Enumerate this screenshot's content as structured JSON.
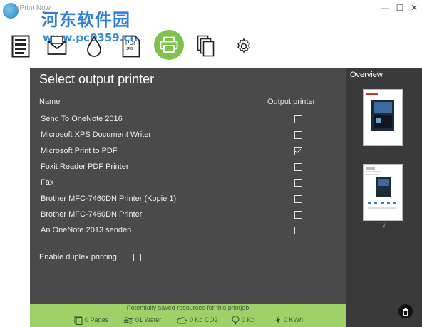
{
  "window": {
    "title": "ePrint Now",
    "watermark_title": "河东软件园",
    "watermark_url": "www.pc0359.cn",
    "controls": {
      "minimize": "—",
      "maximize": "☐",
      "close": "✕"
    }
  },
  "toolbar": {
    "tools": [
      {
        "name": "document",
        "icon": "document-icon"
      },
      {
        "name": "email",
        "icon": "envelope-icon"
      },
      {
        "name": "ink",
        "icon": "drop-icon"
      },
      {
        "name": "pdf",
        "icon": "pdf-icon",
        "label_top": "PDF",
        "label_bottom": "JPG"
      },
      {
        "name": "print",
        "icon": "printer-icon",
        "active": true
      },
      {
        "name": "copies",
        "icon": "copies-icon"
      },
      {
        "name": "settings",
        "icon": "gear-icon"
      }
    ]
  },
  "main": {
    "title": "Select output printer",
    "col_name": "Name",
    "col_output": "Output printer",
    "printers": [
      {
        "name": "Send To OneNote 2016",
        "checked": false
      },
      {
        "name": "Microsoft XPS Document Writer",
        "checked": false
      },
      {
        "name": "Microsoft Print to PDF",
        "checked": true
      },
      {
        "name": "Foxit Reader PDF Printer",
        "checked": false
      },
      {
        "name": "Fax",
        "checked": false
      },
      {
        "name": "Brother MFC-7460DN Printer (Kopie 1)",
        "checked": false
      },
      {
        "name": "Brother MFC-7460DN Printer",
        "checked": false
      },
      {
        "name": "An OneNote 2013 senden",
        "checked": false
      }
    ],
    "duplex_label": "Enable duplex printing",
    "duplex_checked": false
  },
  "savings": {
    "title": "Potentially saved resources for this printjob",
    "pages": "0 Pages",
    "water": "01 Water",
    "co2": "0 Kg  CO2",
    "wood": "0 Kg",
    "energy": "0 KWh"
  },
  "overview": {
    "title": "Overview",
    "pages": [
      {
        "number": "1"
      },
      {
        "number": "2"
      }
    ]
  },
  "colors": {
    "accent_green": "#7fc34a",
    "savings_bar": "#9ed168",
    "panel_bg": "#4a4a4a",
    "overview_bg": "#3a3a3a"
  }
}
